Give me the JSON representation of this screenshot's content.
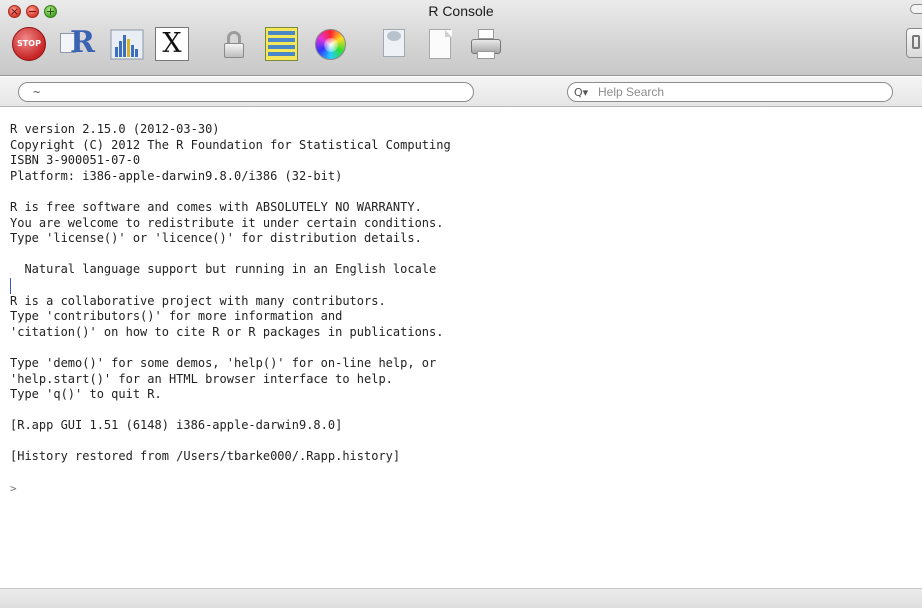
{
  "window": {
    "title": "R Console",
    "traffic_lights": {
      "close": "×",
      "minimize": "−",
      "zoom": "+"
    }
  },
  "toolbar": {
    "stop_label": "STOP",
    "x11_label": "X",
    "items": [
      "stop-icon",
      "source-script-icon",
      "quartz-icon",
      "x11-icon",
      "lock-icon",
      "data-table-icon",
      "color-wheel-icon",
      "print-preview-icon",
      "new-document-icon",
      "print-icon"
    ]
  },
  "searchbar": {
    "working_dir": "~",
    "help_placeholder": "Help Search",
    "help_search_icon": "Q▾"
  },
  "console": {
    "lines": [
      "R version 2.15.0 (2012-03-30)",
      "Copyright (C) 2012 The R Foundation for Statistical Computing",
      "ISBN 3-900051-07-0",
      "Platform: i386-apple-darwin9.8.0/i386 (32-bit)",
      "",
      "R is free software and comes with ABSOLUTELY NO WARRANTY.",
      "You are welcome to redistribute it under certain conditions.",
      "Type 'license()' or 'licence()' for distribution details.",
      "",
      "  Natural language support but running in an English locale",
      "",
      "R is a collaborative project with many contributors.",
      "Type 'contributors()' for more information and",
      "'citation()' on how to cite R or R packages in publications.",
      "",
      "Type 'demo()' for some demos, 'help()' for on-line help, or",
      "'help.start()' for an HTML browser interface to help.",
      "Type 'q()' to quit R.",
      "",
      "[R.app GUI 1.51 (6148) i386-apple-darwin9.8.0]",
      "",
      "[History restored from /Users/tbarke000/.Rapp.history]",
      ""
    ],
    "prompt": ">"
  },
  "colors": {
    "accent_blue": "#3b63b3",
    "stop_red": "#c72424"
  }
}
